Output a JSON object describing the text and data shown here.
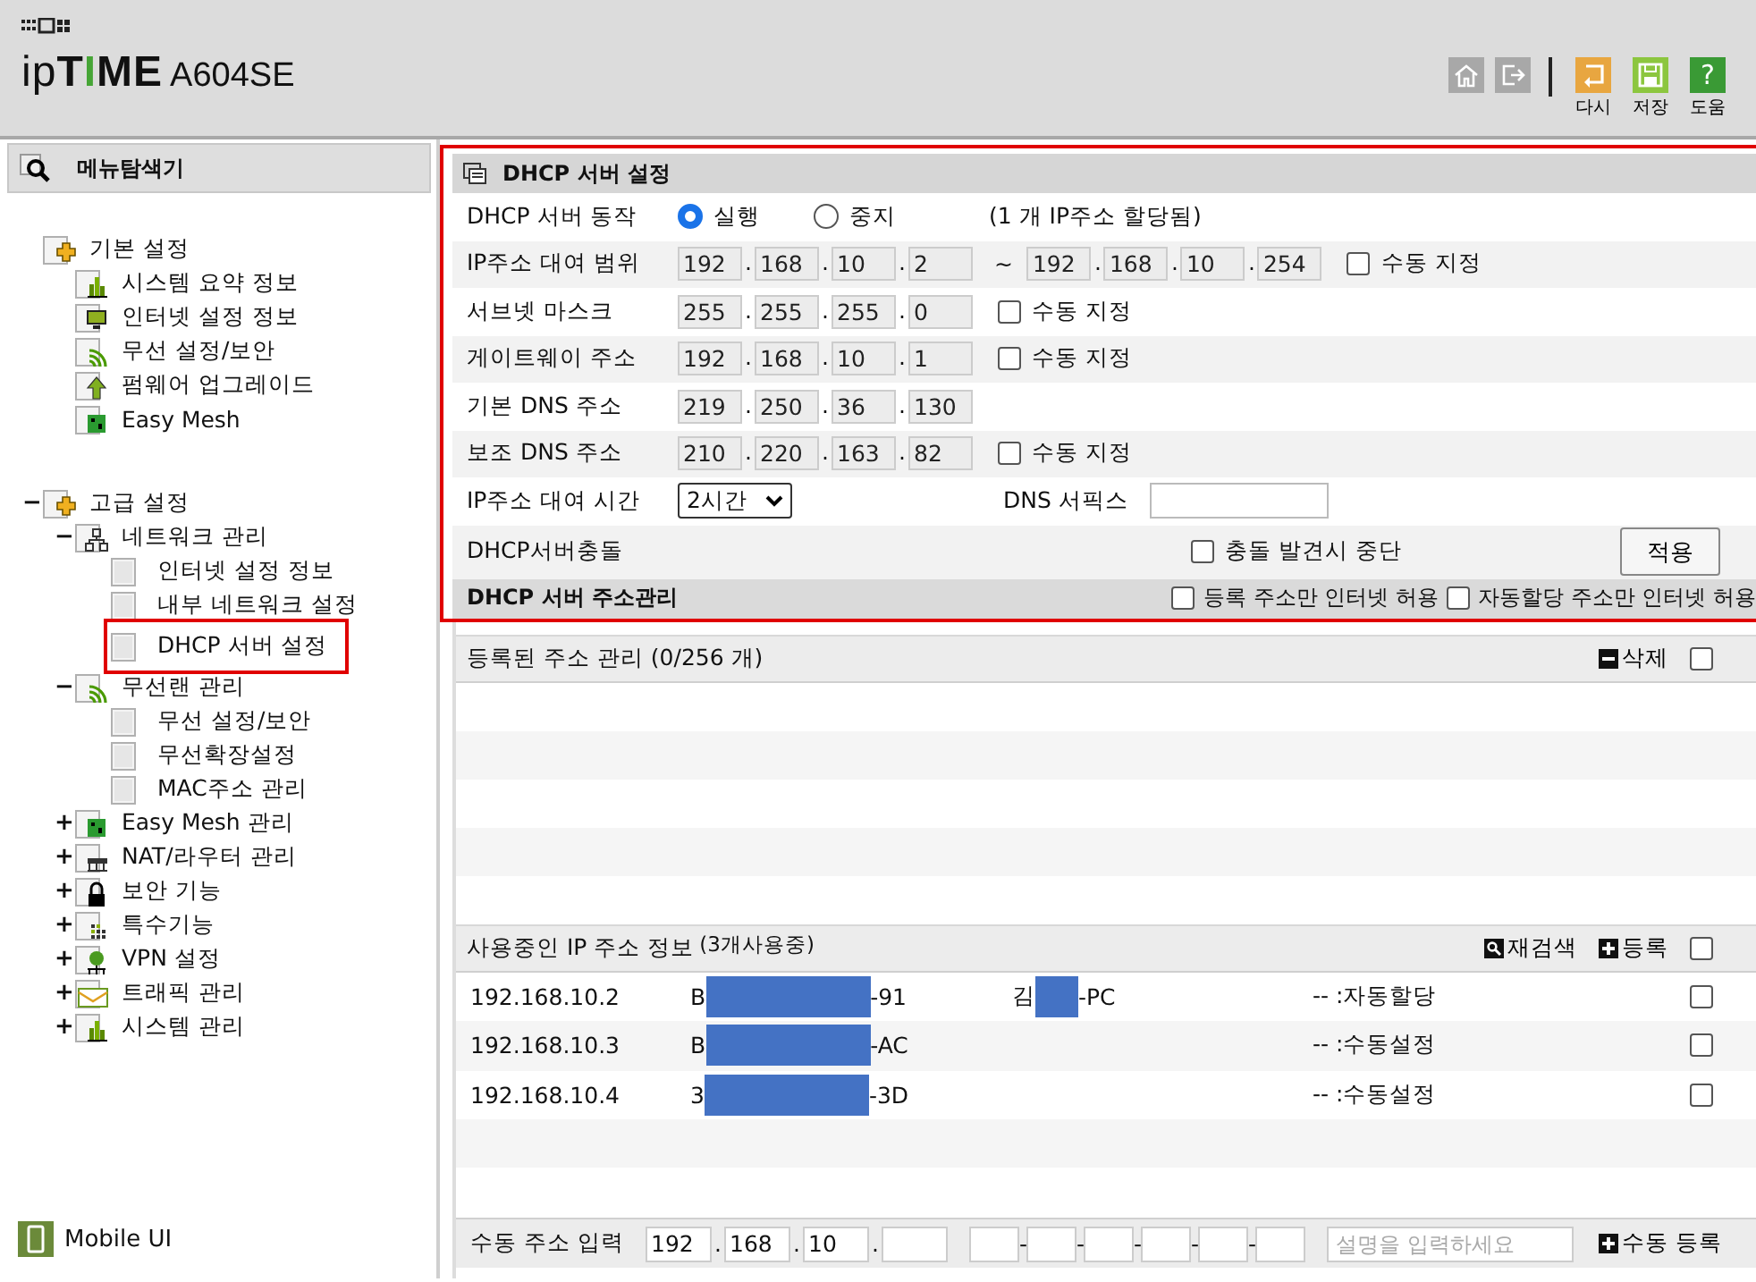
{
  "header": {
    "logo": [
      "ip",
      "T",
      "I",
      "ME"
    ],
    "model": "A604SE",
    "tools": [
      {
        "kind": "home"
      },
      {
        "kind": "logout"
      }
    ],
    "actions": [
      {
        "kind": "undo",
        "label": "다시"
      },
      {
        "kind": "save",
        "label": "저장"
      },
      {
        "kind": "help",
        "glyph": "?",
        "label": "도움"
      }
    ]
  },
  "sidebar": {
    "title": "메뉴탐색기",
    "tree": [
      {
        "label": "기본 설정",
        "kind": "basic",
        "selected": false,
        "children": [
          {
            "label": "시스템 요약 정보",
            "kind": "chart",
            "selected": false
          },
          {
            "label": "인터넷 설정 정보",
            "kind": "monitor",
            "selected": false
          },
          {
            "label": "무선 설정/보안",
            "kind": "wifi",
            "selected": false
          },
          {
            "label": "펌웨어 업그레이드",
            "kind": "upload",
            "selected": false
          },
          {
            "label": "Easy Mesh",
            "kind": "mesh",
            "selected": false
          }
        ]
      },
      {
        "label": "고급 설정",
        "kind": "basic",
        "toggle": "−",
        "selected": false,
        "children": [
          {
            "label": "네트워크 관리",
            "kind": "network",
            "toggle": "−",
            "selected": false,
            "children": [
              {
                "label": "인터넷 설정 정보",
                "kind": "page",
                "selected": false
              },
              {
                "label": "내부 네트워크 설정",
                "kind": "page",
                "selected": false
              },
              {
                "label": "DHCP 서버 설정",
                "kind": "page",
                "selected": true
              }
            ]
          },
          {
            "label": "무선랜 관리",
            "kind": "wifi",
            "toggle": "−",
            "selected": false,
            "children": [
              {
                "label": "무선 설정/보안",
                "kind": "page",
                "selected": false
              },
              {
                "label": "무선확장설정",
                "kind": "page",
                "selected": false
              },
              {
                "label": "MAC주소 관리",
                "kind": "page",
                "selected": false
              }
            ]
          },
          {
            "label": "Easy Mesh 관리",
            "kind": "mesh",
            "toggle": "+",
            "selected": false
          },
          {
            "label": "NAT/라우터 관리",
            "kind": "router",
            "toggle": "+",
            "selected": false
          },
          {
            "label": "보안 기능",
            "kind": "lock",
            "toggle": "+",
            "selected": false
          },
          {
            "label": "특수기능",
            "kind": "grid",
            "toggle": "+",
            "selected": false
          },
          {
            "label": "VPN 설정",
            "kind": "vpn",
            "toggle": "+",
            "selected": false
          },
          {
            "label": "트래픽 관리",
            "kind": "traffic",
            "toggle": "+",
            "selected": false
          },
          {
            "label": "시스템 관리",
            "kind": "chart",
            "toggle": "+",
            "selected": false
          }
        ]
      }
    ],
    "mobile": "Mobile UI"
  },
  "settings": {
    "title": "DHCP 서버 설정",
    "highlighted": true,
    "rows": [
      {
        "kind": "radio",
        "label": "DHCP 서버 동작",
        "options": [
          {
            "label": "실행",
            "selected": true
          },
          {
            "label": "중지",
            "selected": false
          }
        ],
        "note": "(1 개 IP주소 할당됨)"
      },
      {
        "kind": "ip",
        "label": "IP주소 대여 범위",
        "disabled": true,
        "range_sep": "~",
        "addresses": [
          [
            {
              "value": "192"
            },
            {
              "sep": ".",
              "value": "168"
            },
            {
              "sep": ".",
              "value": "10"
            },
            {
              "sep": ".",
              "value": "2"
            }
          ],
          [
            {
              "value": "192"
            },
            {
              "sep": ".",
              "value": "168"
            },
            {
              "sep": ".",
              "value": "10"
            },
            {
              "sep": ".",
              "value": "254"
            }
          ]
        ],
        "manual": {
          "label": "수동 지정",
          "checked": false
        }
      },
      {
        "kind": "ip",
        "label": "서브넷 마스크",
        "disabled": true,
        "addresses": [
          [
            {
              "value": "255"
            },
            {
              "sep": ".",
              "value": "255"
            },
            {
              "sep": ".",
              "value": "255"
            },
            {
              "sep": ".",
              "value": "0"
            }
          ]
        ],
        "manual": {
          "label": "수동 지정",
          "checked": false
        }
      },
      {
        "kind": "ip",
        "label": "게이트웨이 주소",
        "disabled": true,
        "addresses": [
          [
            {
              "value": "192"
            },
            {
              "sep": ".",
              "value": "168"
            },
            {
              "sep": ".",
              "value": "10"
            },
            {
              "sep": ".",
              "value": "1"
            }
          ]
        ],
        "manual": {
          "label": "수동 지정",
          "checked": false
        }
      },
      {
        "kind": "ip",
        "label": "기본 DNS 주소",
        "disabled": true,
        "addresses": [
          [
            {
              "value": "219"
            },
            {
              "sep": ".",
              "value": "250"
            },
            {
              "sep": ".",
              "value": "36"
            },
            {
              "sep": ".",
              "value": "130"
            }
          ]
        ]
      },
      {
        "kind": "ip",
        "label": "보조 DNS 주소",
        "disabled": true,
        "addresses": [
          [
            {
              "value": "210"
            },
            {
              "sep": ".",
              "value": "220"
            },
            {
              "sep": ".",
              "value": "163"
            },
            {
              "sep": ".",
              "value": "82"
            }
          ]
        ],
        "manual": {
          "label": "수동 지정",
          "checked": false
        }
      },
      {
        "kind": "lease",
        "label": "IP주소 대여 시간",
        "select": "2시간",
        "suffix_label": "DNS 서픽스"
      },
      {
        "kind": "conflict",
        "label": "DHCP서버충돌",
        "check": {
          "label": "충돌 발견시 중단",
          "checked": false
        },
        "button": "적용"
      }
    ],
    "footer": {
      "title": "DHCP 서버 주소관리",
      "checks": [
        {
          "label": "등록 주소만 인터넷 허용",
          "checked": false
        },
        {
          "label": "자동할당 주소만 인터넷 허용",
          "checked": false
        }
      ]
    }
  },
  "registered": {
    "title": "등록된 주소 관리 (0/256 개)",
    "delete": "삭제",
    "select_all": false
  },
  "in_use": {
    "title": "사용중인 IP 주소 정보",
    "count": "(3개사용중)",
    "rescan": "재검색",
    "register": "등록",
    "select_all": false,
    "rows": [
      {
        "ip": "192.168.10.2",
        "mac_start": "B",
        "mac_end": "-91",
        "host_start": "김",
        "host_end": "-PC",
        "status": "-- :자동할당",
        "checked": false
      },
      {
        "ip": "192.168.10.3",
        "mac_start": "B",
        "mac_end": "-AC",
        "status": "-- :수동설정",
        "checked": false
      },
      {
        "ip": "192.168.10.4",
        "mac_start": "3",
        "mac_end": "-3D",
        "status": "-- :수동설정",
        "checked": false
      }
    ]
  },
  "manual_entry": {
    "label": "수동 주소 입력",
    "octets": [
      {
        "value": "192"
      },
      {
        "sep": ".",
        "value": "168"
      },
      {
        "sep": ".",
        "value": "10"
      },
      {
        "sep": "."
      }
    ],
    "mac_seps": [
      "-",
      "-",
      "-",
      "-",
      "-"
    ],
    "placeholder": "설명을 입력하세요",
    "button": "수동 등록"
  }
}
